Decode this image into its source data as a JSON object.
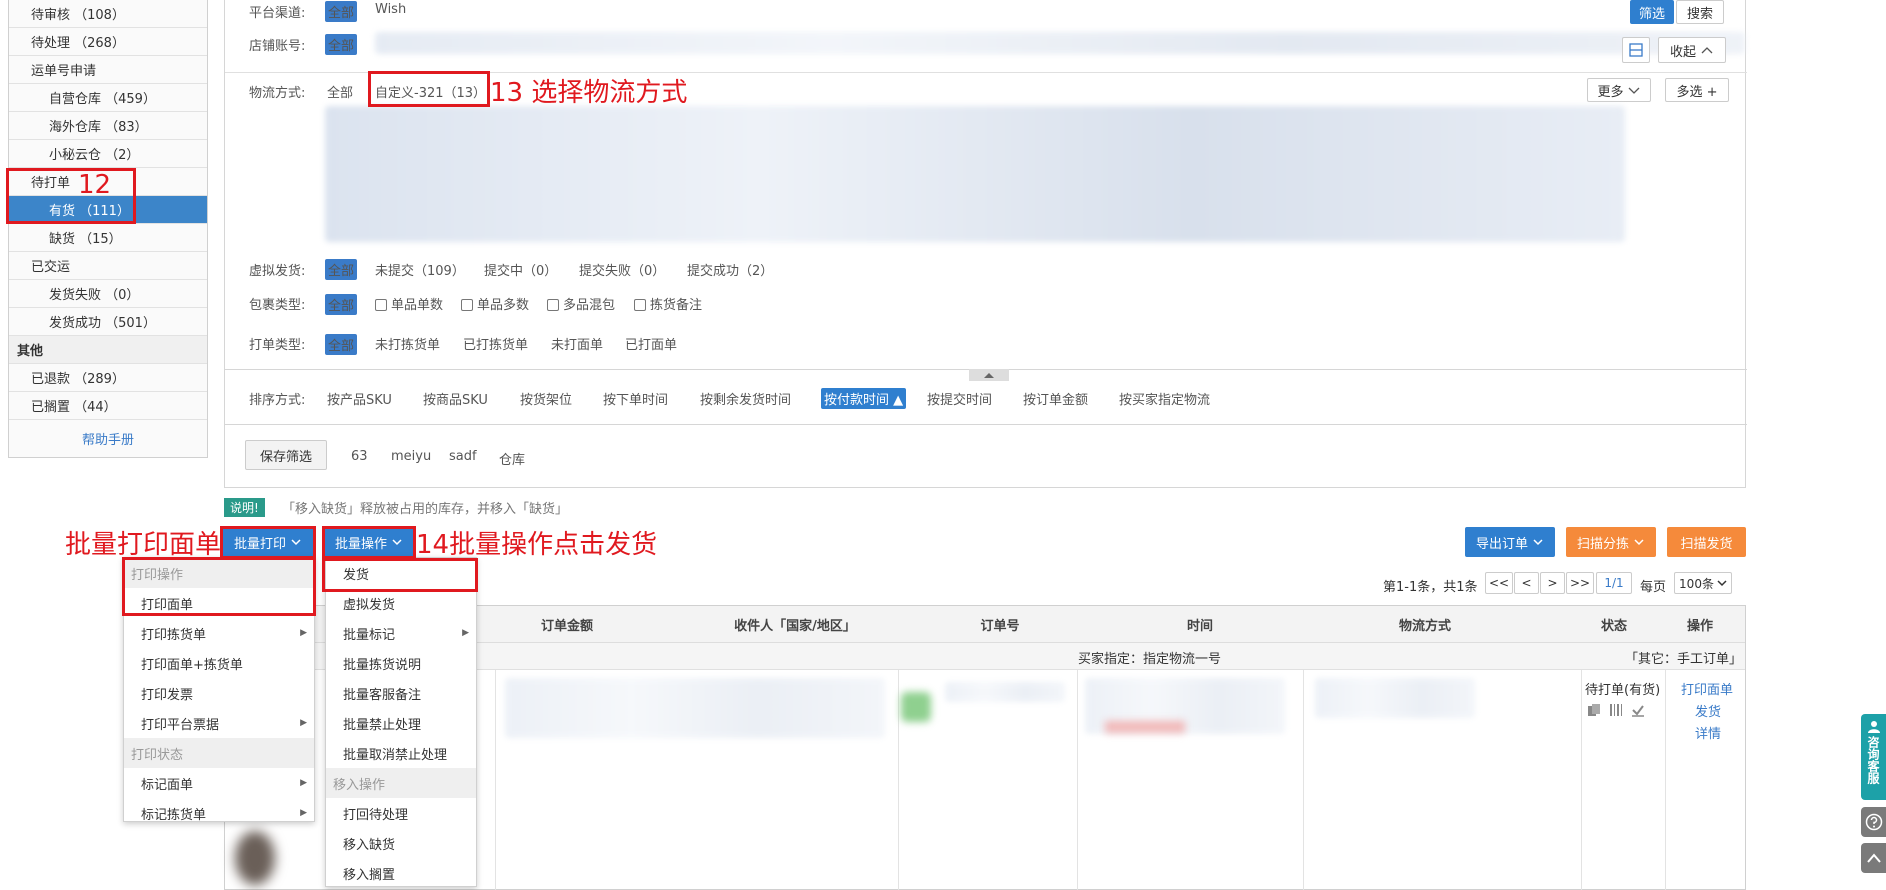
{
  "sidebar": {
    "items": [
      {
        "label": "待审核 （108）",
        "level": 1
      },
      {
        "label": "待处理 （268）",
        "level": 1
      },
      {
        "label": "运单号申请",
        "level": 1
      },
      {
        "label": "自营仓库 （459）",
        "level": 2
      },
      {
        "label": "海外仓库 （83）",
        "level": 2
      },
      {
        "label": "小秘云仓 （2）",
        "level": 2
      },
      {
        "label": "待打单",
        "level": 1
      },
      {
        "label": "有货 （111）",
        "level": 2,
        "active": true
      },
      {
        "label": "缺货 （15）",
        "level": 2
      },
      {
        "label": "已交运",
        "level": 1
      },
      {
        "label": "发货失败 （0）",
        "level": 2
      },
      {
        "label": "发货成功 （501）",
        "level": 2
      },
      {
        "label": "其他",
        "level": 0
      },
      {
        "label": "已退款 （289）",
        "level": 1
      },
      {
        "label": "已搁置 （44）",
        "level": 1
      }
    ],
    "help": "帮助手册"
  },
  "filter": {
    "platform_label": "平台渠道:",
    "platform_all": "全部",
    "platform_wish": "Wish",
    "shop_label": "店铺账号:",
    "shop_all": "全部",
    "btn_filter": "筛选",
    "btn_search": "搜索",
    "btn_collapse": "收起",
    "logistics_label": "物流方式:",
    "logistics_all": "全部",
    "logistics_custom": "自定义-321（13）",
    "btn_more": "更多",
    "btn_multi": "多选 +",
    "virtual_label": "虚拟发货:",
    "virtual_all": "全部",
    "virtual_opts": [
      "未提交（109）",
      "提交中（0）",
      "提交失败（0）",
      "提交成功（2）"
    ],
    "package_label": "包裹类型:",
    "package_all": "全部",
    "package_opts": [
      "单品单数",
      "单品多数",
      "多品混包",
      "拣货备注"
    ],
    "print_label": "打单类型:",
    "print_all": "全部",
    "print_opts": [
      "未打拣货单",
      "已打拣货单",
      "未打面单",
      "已打面单"
    ],
    "sort_label": "排序方式:",
    "sort_opts": [
      "按产品SKU",
      "按商品SKU",
      "按货架位",
      "按下单时间",
      "按剩余发货时间"
    ],
    "sort_active": "按付款时间",
    "sort_opts2": [
      "按提交时间",
      "按订单金额",
      "按买家指定物流"
    ],
    "save_filter": "保存筛选",
    "saved": [
      "63",
      "meiyu",
      "sadf",
      "仓库"
    ]
  },
  "notice": {
    "tag": "说明!",
    "text": "「移入缺货」释放被占用的库存，并移入「缺货」"
  },
  "toolbar": {
    "batch_print": "批量打印",
    "batch_ops": "批量操作",
    "export": "导出订单",
    "scan_sort": "扫描分拣",
    "scan_ship": "扫描发货",
    "pagination": "第1-1条，共1条",
    "pages": [
      "<<",
      "<",
      ">",
      ">>"
    ],
    "page_current": "1/1",
    "per_page_label": "每页",
    "per_page": "100条"
  },
  "print_menu": {
    "group1": "打印操作",
    "items1": [
      "打印面单",
      "打印拣货单",
      "打印面单+拣货单",
      "打印发票",
      "打印平台票据"
    ],
    "group2": "打印状态",
    "items2": [
      "标记面单",
      "标记拣货单"
    ]
  },
  "ops_menu": {
    "items1": [
      "发货",
      "虚拟发货",
      "批量标记",
      "批量拣货说明",
      "批量客服备注",
      "批量禁止处理",
      "批量取消禁止处理"
    ],
    "group": "移入操作",
    "items2": [
      "打回待处理",
      "移入缺货",
      "移入搁置"
    ]
  },
  "table": {
    "headers": [
      "订单金额",
      "收件人「国家/地区」",
      "订单号",
      "时间",
      "物流方式",
      "状态",
      "操作"
    ],
    "buyer_note": "买家指定：指定物流一号",
    "other": "「其它：手工订单」",
    "status": "待打单(有货)",
    "actions": [
      "打印面单",
      "发货",
      "详情"
    ]
  },
  "annotations": {
    "a12": "12",
    "a13": "13 选择物流方式",
    "a14": "14批量操作点击发货",
    "a_print": "批量打印面单"
  },
  "side_widget": {
    "consult": "咨询客服"
  }
}
